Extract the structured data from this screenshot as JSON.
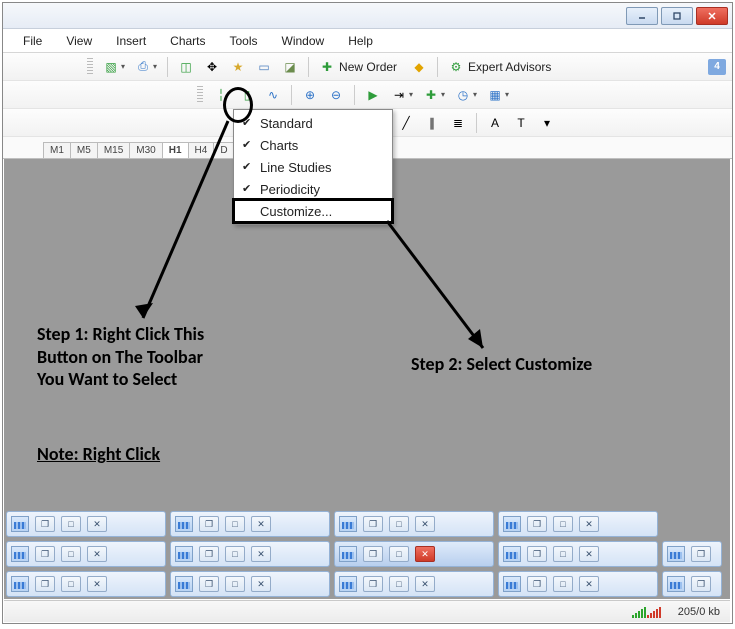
{
  "window": {
    "min_tip": "Minimize",
    "max_tip": "Restore",
    "close_tip": "Close"
  },
  "menu": [
    "File",
    "View",
    "Insert",
    "Charts",
    "Tools",
    "Window",
    "Help"
  ],
  "toolbar1": {
    "new_order_label": "New Order",
    "expert_advisors_label": "Expert Advisors",
    "badge": "4"
  },
  "periods": [
    "M1",
    "M5",
    "M15",
    "M30",
    "H1",
    "H4",
    "D"
  ],
  "active_period": "H1",
  "context_menu": {
    "items": [
      {
        "label": "Standard",
        "checked": true
      },
      {
        "label": "Charts",
        "checked": true
      },
      {
        "label": "Line Studies",
        "checked": true
      },
      {
        "label": "Periodicity",
        "checked": true
      },
      {
        "label": "Customize...",
        "checked": false,
        "highlight": true
      }
    ]
  },
  "annotations": {
    "step1": "Step 1: Right Click This\nButton on The Toolbar\nYou Want to Select",
    "step2": "Step 2: Select Customize",
    "note": "Note: Right Click"
  },
  "status": {
    "transfer": "205/0 kb"
  },
  "icons": {
    "plus_green": "＋",
    "arrow": "▾",
    "printer": "🖶",
    "target": "⌖",
    "star": "★",
    "sheet": "▭",
    "search": "🔍",
    "doc_plus": "✚",
    "warn": "⚠",
    "gears": "⚙",
    "bar": "▮",
    "candle": "╿",
    "line": "─",
    "zoom_in": "⊕",
    "zoom_out": "⊖",
    "indicator": "∿",
    "clock": "◷",
    "layout": "▦",
    "cursor": "↖",
    "crosshair": "┼",
    "vline": "│",
    "hline": "—",
    "trend": "╱",
    "equi": "≡",
    "fib": "⋮",
    "text_a": "A",
    "text_t": "T"
  }
}
